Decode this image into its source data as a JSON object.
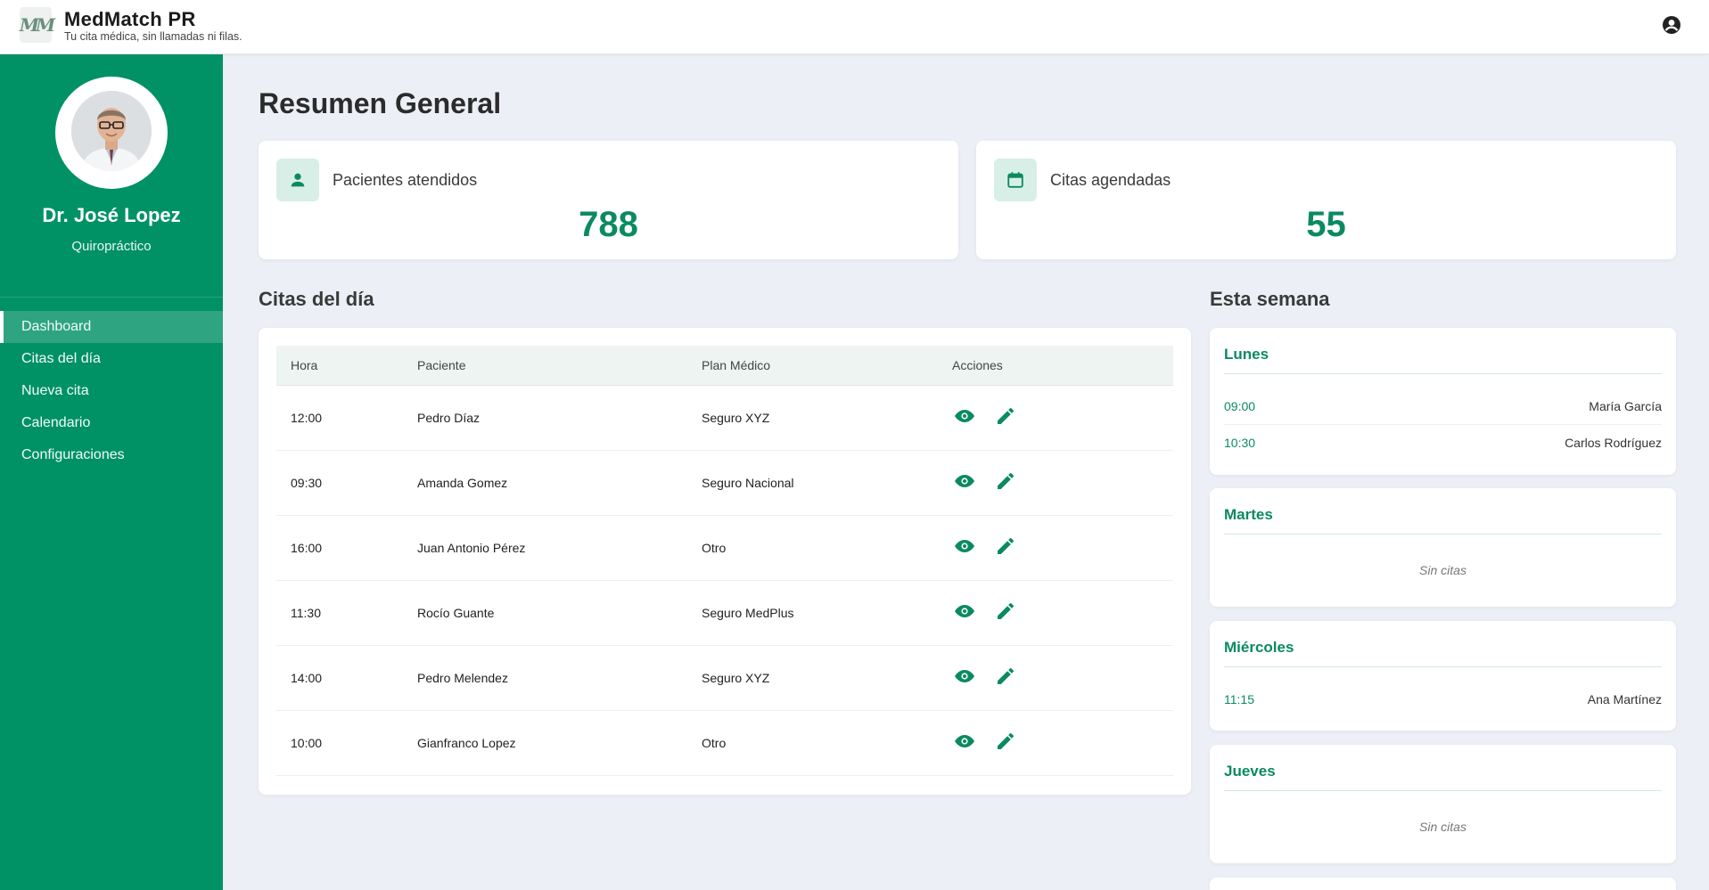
{
  "app": {
    "name": "MedMatch PR",
    "tagline": "Tu cita médica, sin llamadas ni filas.",
    "logo_text": "MM"
  },
  "colors": {
    "brand_green": "#009165",
    "accent_green": "#0b8a61",
    "page_bg": "#ecf0f6"
  },
  "icons": {
    "user_account": "account-circle-icon",
    "patients": "person-icon",
    "appointments": "calendar-icon",
    "view": "eye-icon",
    "edit": "pencil-icon"
  },
  "profile": {
    "name": "Dr. José Lopez",
    "role": "Quiropráctico"
  },
  "nav": {
    "items": [
      {
        "label": "Dashboard",
        "active": true
      },
      {
        "label": "Citas del día",
        "active": false
      },
      {
        "label": "Nueva cita",
        "active": false
      },
      {
        "label": "Calendario",
        "active": false
      },
      {
        "label": "Configuraciones",
        "active": false
      }
    ]
  },
  "main": {
    "title": "Resumen General",
    "stats": [
      {
        "label": "Pacientes atendidos",
        "value": "788"
      },
      {
        "label": "Citas agendadas",
        "value": "55"
      }
    ]
  },
  "today": {
    "title": "Citas del día",
    "columns": [
      "Hora",
      "Paciente",
      "Plan Médico",
      "Acciones"
    ],
    "rows": [
      {
        "time": "12:00",
        "patient": "Pedro Díaz",
        "plan": "Seguro XYZ"
      },
      {
        "time": "09:30",
        "patient": "Amanda Gomez",
        "plan": "Seguro Nacional"
      },
      {
        "time": "16:00",
        "patient": "Juan Antonio Pérez",
        "plan": "Otro"
      },
      {
        "time": "11:30",
        "patient": "Rocío Guante",
        "plan": "Seguro MedPlus"
      },
      {
        "time": "14:00",
        "patient": "Pedro Melendez",
        "plan": "Seguro XYZ"
      },
      {
        "time": "10:00",
        "patient": "Gianfranco Lopez",
        "plan": "Otro"
      }
    ]
  },
  "week": {
    "title": "Esta semana",
    "days": [
      {
        "name": "Lunes",
        "appointments": [
          {
            "time": "09:00",
            "patient": "María García"
          },
          {
            "time": "10:30",
            "patient": "Carlos Rodríguez"
          }
        ]
      },
      {
        "name": "Martes",
        "empty_text": "Sin citas"
      },
      {
        "name": "Miércoles",
        "appointments": [
          {
            "time": "11:15",
            "patient": "Ana Martínez"
          }
        ]
      },
      {
        "name": "Jueves",
        "empty_text": "Sin citas"
      }
    ]
  }
}
